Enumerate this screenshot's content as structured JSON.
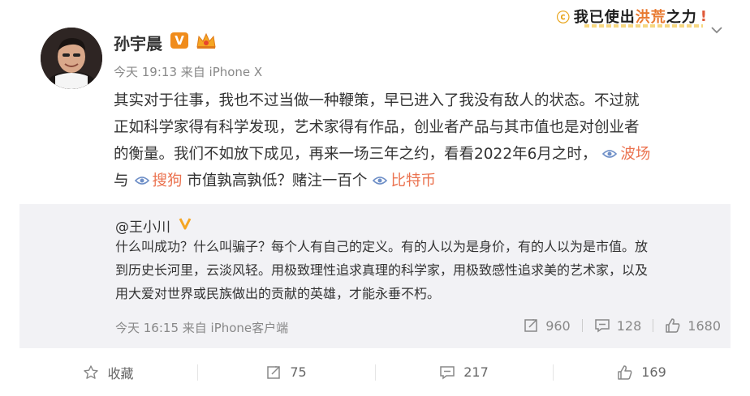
{
  "slogan": {
    "part1": "我已使出",
    "part2": "洪荒",
    "part3": "之力",
    "part4": "!"
  },
  "post": {
    "username": "孙宇晨",
    "verified_badge": "V",
    "meta": "今天 19:13 来自 iPhone X",
    "lines": [
      "其实对于往事，我也不过当做一种鞭策，早已进入了我没有敌人的状态。不过就",
      "正如科学家得有科学发现，艺术家得有作品，创业者产品与其市值也是对创业者",
      "的衡量。我们不如放下成见，再来一场三年之约，看看2022年6月之时，"
    ],
    "topic1": "波场",
    "line4_a": "与",
    "topic2": "搜狗",
    "line4_b": "市值孰高孰低？赌注一百个",
    "topic3": "比特币"
  },
  "repost": {
    "user": "@王小川",
    "lines": [
      "什么叫成功？什么叫骗子？每个人有自己的定义。有的人以为是身价，有的人以为是市值。放",
      "到历史长河里，云淡风轻。用极致理性追求真理的科学家，用极致感性追求美的艺术家，以及",
      "用大爱对世界或民族做出的贡献的英雄，才能永垂不朽。"
    ],
    "meta": "今天 16:15 来自 iPhone客户端",
    "reposts": "960",
    "comments": "128",
    "likes": "1680"
  },
  "actions": {
    "favorite": "收藏",
    "repost": "75",
    "comment": "217",
    "like": "169"
  },
  "colors": {
    "topic": "#eb7350",
    "badge": "#f08c1c",
    "repost_bg": "#f2f2f5"
  },
  "icons": [
    "chevron-down-icon",
    "crown-icon",
    "topic-icon",
    "star-icon",
    "repost-icon",
    "comment-icon",
    "like-icon"
  ]
}
